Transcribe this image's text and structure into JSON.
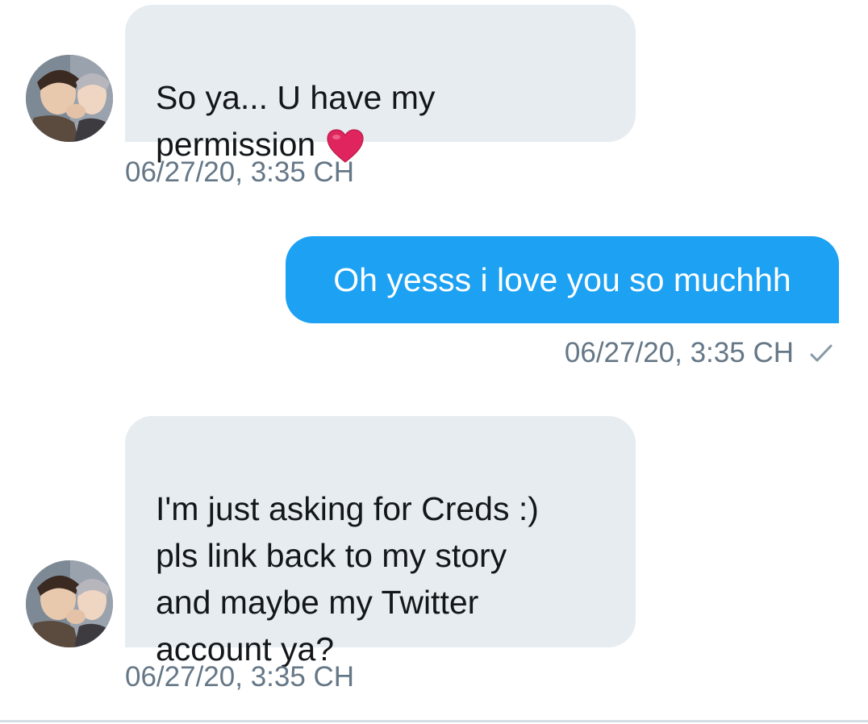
{
  "messages": [
    {
      "direction": "received",
      "text": "So ya... U have my\npermission",
      "emoji": "red-heart",
      "timestamp": "06/27/20, 3:35 CH"
    },
    {
      "direction": "sent",
      "text": "Oh yesss i love you so muchhh",
      "timestamp": "06/27/20, 3:35 CH",
      "status": "sent-check"
    },
    {
      "direction": "received",
      "text": "I'm just asking for Creds :)\npls link back to my story\nand maybe my Twitter\naccount ya?",
      "timestamp": "06/27/20, 3:35 CH"
    }
  ],
  "colors": {
    "received_bubble": "#e6ecf0",
    "sent_bubble": "#1da1f2",
    "timestamp": "#657786",
    "heart": "#e0245e"
  }
}
